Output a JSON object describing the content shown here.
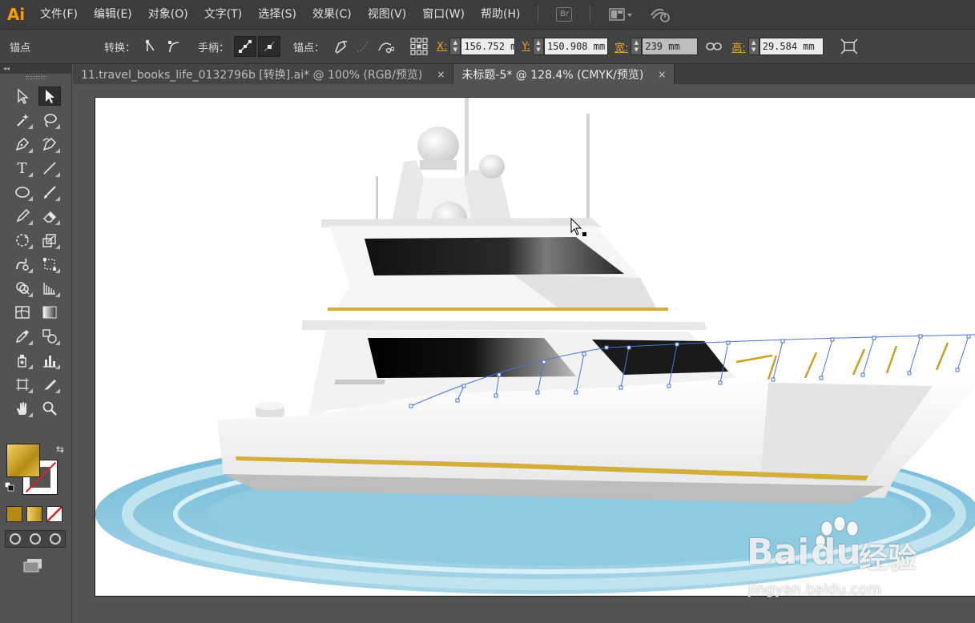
{
  "menubar": {
    "logo": "Ai",
    "items": [
      "文件(F)",
      "编辑(E)",
      "对象(O)",
      "文字(T)",
      "选择(S)",
      "效果(C)",
      "视图(V)",
      "窗口(W)",
      "帮助(H)"
    ],
    "bridge_label": "Br"
  },
  "controlbar": {
    "mode_label": "锚点",
    "convert_label": "转换：",
    "handles_label": "手柄：",
    "anchors_label": "锚点：",
    "x_label": "X:",
    "x_value": "156.752 mm",
    "y_label": "Y:",
    "y_value": "150.908 mm",
    "w_label": "宽:",
    "w_value": "239 mm",
    "h_label": "高:",
    "h_value": "29.584 mm"
  },
  "toolpanel": {
    "collapse_glyph": "◂◂",
    "type_tool_glyph": "T"
  },
  "tabs": [
    {
      "label": "11.travel_books_life_0132796b [转换].ai* @ 100% (RGB/预览)",
      "close": "×"
    },
    {
      "label": "未标题-5* @ 128.4% (CMYK/预览)",
      "close": "×"
    }
  ],
  "colors": {
    "fill_gradient_mid": "#b58a14",
    "stroke_none": "#e02020",
    "accent": "#ff9a00",
    "field_label": "#e8a534",
    "selection_path": "#4a74d8"
  },
  "watermark": {
    "brand_text": "Bai",
    "brand_text_2": "du",
    "cn_text": "经验",
    "url": "jingyan.baidu.com"
  }
}
